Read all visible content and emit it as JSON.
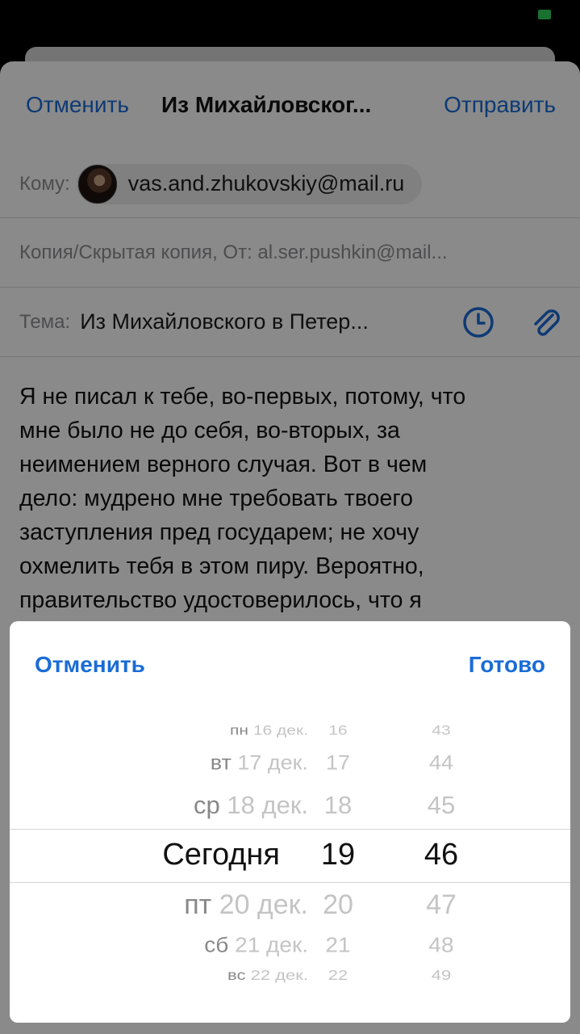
{
  "compose": {
    "cancel_label": "Отменить",
    "title": "Из Михайловског...",
    "send_label": "Отправить",
    "to_label": "Кому:",
    "to_email": "vas.and.zhukovskiy@mail.ru",
    "cc_text": "Копия/Скрытая копия, От: al.ser.pushkin@mail...",
    "subject_label": "Тема:",
    "subject_value": "Из Михайловского в Петер...",
    "body_lines": [
      "Я не писал к тебе, во-первых, потому, что",
      "мне было не до себя, во-вторых, за",
      "неимением верного случая. Вот в чем",
      "дело: мудрено мне требовать твоего",
      "заступления пред государем; не хочу",
      "охмелить тебя в этом пиру. Вероятно,",
      "правительство удостоверилось, что я"
    ]
  },
  "picker": {
    "cancel_label": "Отменить",
    "done_label": "Готово",
    "rows": [
      {
        "day": "пн",
        "date": "16 дек.",
        "hour": "16",
        "minute": "43"
      },
      {
        "day": "вт",
        "date": "17 дек.",
        "hour": "17",
        "minute": "44"
      },
      {
        "day": "ср",
        "date": "18 дек.",
        "hour": "18",
        "minute": "45"
      },
      {
        "day": "",
        "date": "Сегодня",
        "hour": "19",
        "minute": "46"
      },
      {
        "day": "пт",
        "date": "20 дек.",
        "hour": "20",
        "minute": "47"
      },
      {
        "day": "сб",
        "date": "21 дек.",
        "hour": "21",
        "minute": "48"
      },
      {
        "day": "вс",
        "date": "22 дек.",
        "hour": "22",
        "minute": "49"
      }
    ]
  },
  "icons": {
    "schedule": "clock-icon",
    "attach": "paperclip-icon"
  },
  "colors": {
    "accent": "#1a6cd6",
    "battery": "#31d158"
  }
}
